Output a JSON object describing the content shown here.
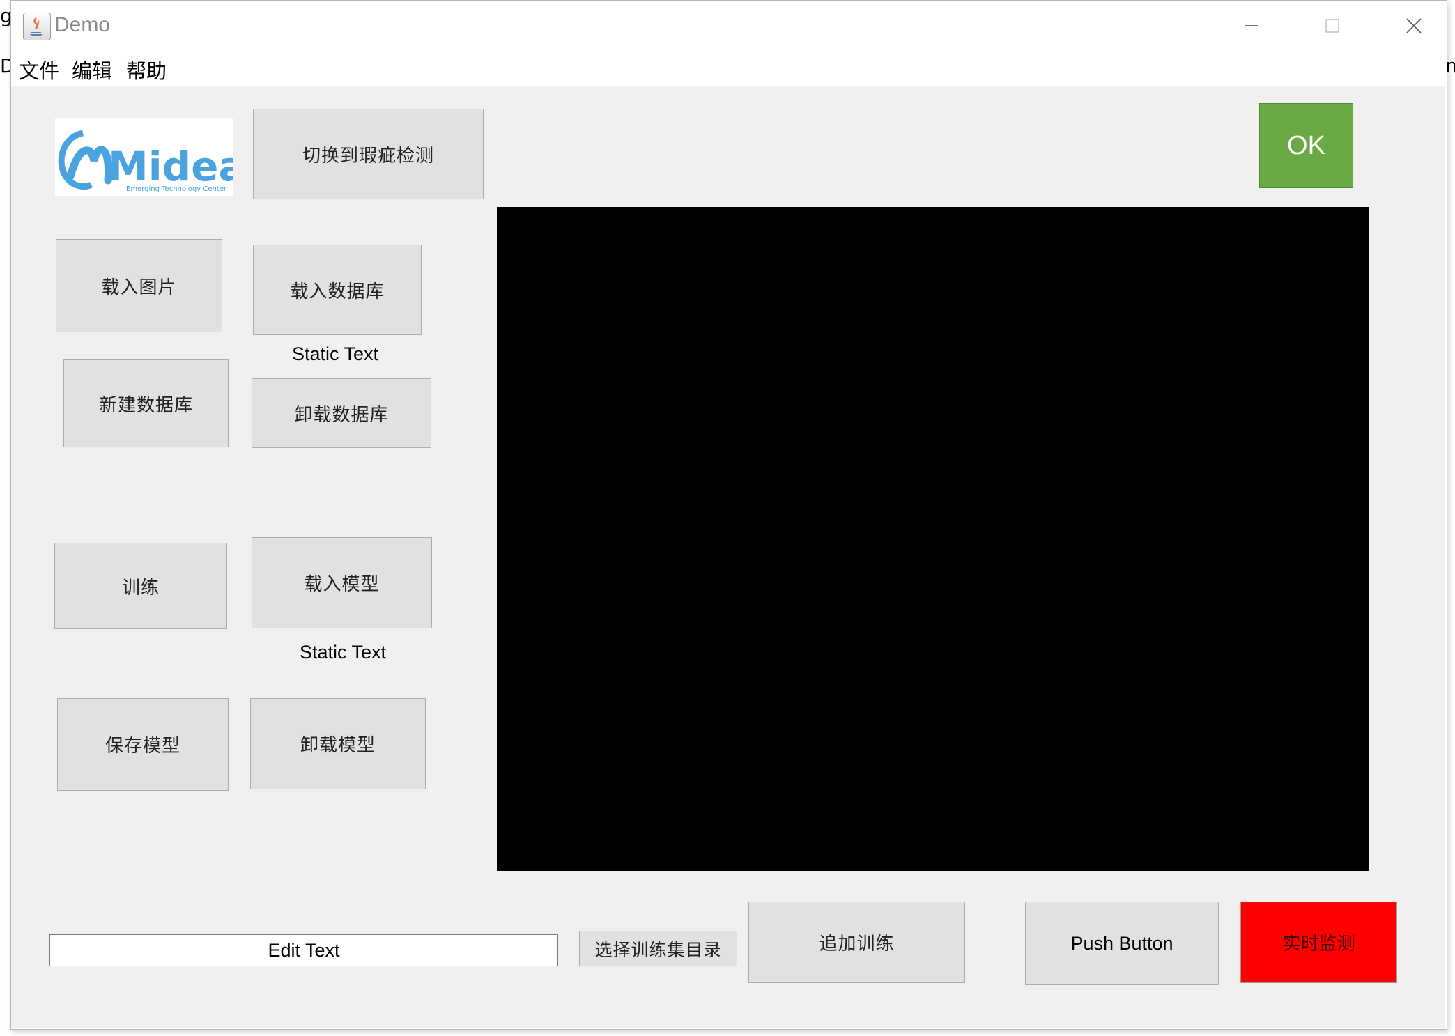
{
  "background": {
    "left_fragment_top": "ge",
    "left_fragment_mid": "D",
    "right_fragment": "n"
  },
  "window": {
    "title": "Demo"
  },
  "menu": {
    "items": [
      "文件",
      "编辑",
      "帮助"
    ]
  },
  "logo": {
    "brand": "Midea",
    "subtitle": "Emerging Technology Center"
  },
  "buttons": {
    "switch_detect": "切换到瑕疵检测",
    "load_image": "载入图片",
    "load_database": "载入数据库",
    "new_database": "新建数据库",
    "unload_database": "卸载数据库",
    "train": "训练",
    "load_model": "载入模型",
    "save_model": "保存模型",
    "unload_model": "卸载模型",
    "select_train_dir": "选择训练集目录",
    "append_train": "追加训练",
    "push_button": "Push Button",
    "realtime_monitor": "实时监测",
    "ok": "OK"
  },
  "static_texts": {
    "database_status": "Static Text",
    "model_status": "Static Text"
  },
  "edit_text": {
    "value": "Edit Text"
  },
  "colors": {
    "ok_green": "#6aaa45",
    "monitor_red": "#ff0000",
    "display_black": "#000000",
    "logo_blue": "#4aa3df"
  }
}
